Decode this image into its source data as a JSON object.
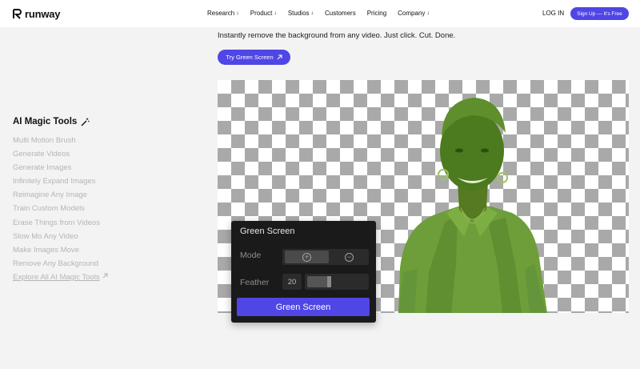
{
  "brand": {
    "name": "runway",
    "accent": "#4f46e5"
  },
  "nav": [
    {
      "label": "Research",
      "has_dropdown": true,
      "arrow": "↓"
    },
    {
      "label": "Product",
      "has_dropdown": true,
      "arrow": "↓"
    },
    {
      "label": "Studios",
      "has_dropdown": true,
      "arrow": "↓"
    },
    {
      "label": "Customers",
      "has_dropdown": false,
      "arrow": ""
    },
    {
      "label": "Pricing",
      "has_dropdown": false,
      "arrow": ""
    },
    {
      "label": "Company",
      "has_dropdown": true,
      "arrow": "↓"
    }
  ],
  "auth": {
    "login": "LOG IN",
    "signup": "Sign Up — It's Free"
  },
  "hero": {
    "tagline": "Instantly remove the background from any video. Just click. Cut. Done.",
    "cta": "Try Green Screen",
    "cta_icon": "arrow-up-right-icon"
  },
  "tools": {
    "title": "AI Magic Tools",
    "title_icon": "magic-wand-icon",
    "items": [
      "Multi Motion Brush",
      "Generate Videos",
      "Generate Images",
      "Infinitely Expand Images",
      "Reimagine Any Image",
      "Train Custom Models",
      "Erase Things from Videos",
      "Slow Mo Any Video",
      "Make Images Move",
      "Remove Any Background"
    ],
    "explore": "Explore All AI Magic Tools",
    "explore_icon": "arrow-up-right-icon"
  },
  "panel": {
    "title": "Green Screen",
    "mode_label": "Mode",
    "mode_add_icon": "plus-circle-icon",
    "mode_subtract_icon": "minus-circle-icon",
    "feather_label": "Feather",
    "feather_value": "20",
    "feather_fraction": 0.4,
    "button": "Green Screen"
  }
}
